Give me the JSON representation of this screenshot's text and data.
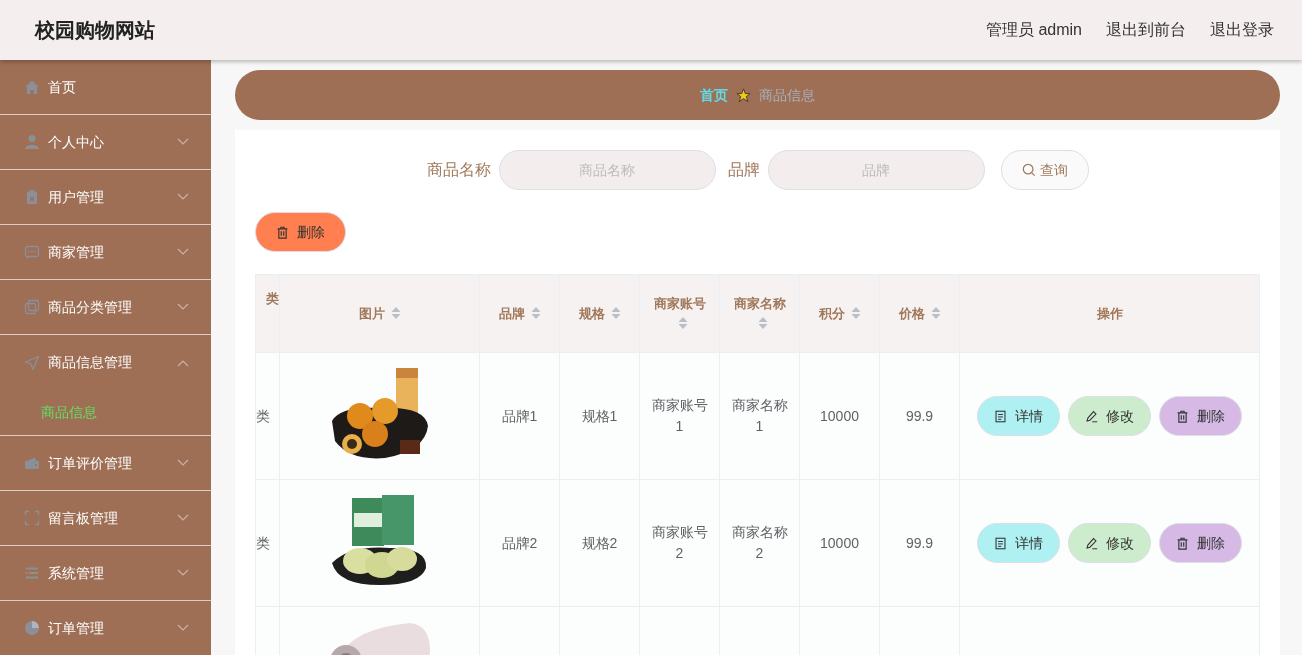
{
  "header": {
    "title": "校园购物网站",
    "links": [
      {
        "label": "管理员 admin"
      },
      {
        "label": "退出到前台"
      },
      {
        "label": "退出登录"
      }
    ]
  },
  "sidebar": {
    "items": [
      {
        "label": "首页"
      },
      {
        "label": "个人中心",
        "expanded": false
      },
      {
        "label": "用户管理",
        "expanded": false
      },
      {
        "label": "商家管理",
        "expanded": false
      },
      {
        "label": "商品分类管理",
        "expanded": false
      },
      {
        "label": "商品信息管理",
        "expanded": true,
        "children": [
          {
            "label": "商品信息",
            "selected": true
          }
        ]
      },
      {
        "label": "订单评价管理",
        "expanded": false
      },
      {
        "label": "留言板管理",
        "expanded": false
      },
      {
        "label": "系统管理",
        "expanded": false
      },
      {
        "label": "订单管理",
        "expanded": false
      }
    ]
  },
  "breadcrumb": [
    {
      "label": "首页"
    },
    {
      "label": "商品信息"
    }
  ],
  "search": {
    "fields": [
      {
        "label": "商品名称",
        "placeholder": "商品名称"
      },
      {
        "label": "品牌",
        "placeholder": "品牌"
      }
    ],
    "button": "查询"
  },
  "toolbar": {
    "delete_button": "删除"
  },
  "table": {
    "columns": [
      {
        "label": "类",
        "sortable": false
      },
      {
        "label": "图片",
        "sortable": true
      },
      {
        "label": "品牌",
        "sortable": true
      },
      {
        "label": "规格",
        "sortable": true
      },
      {
        "label": "商家账号",
        "sortable": true
      },
      {
        "label": "商家名称",
        "sortable": true
      },
      {
        "label": "积分",
        "sortable": true
      },
      {
        "label": "价格",
        "sortable": true
      },
      {
        "label": "操作",
        "sortable": false
      }
    ],
    "rows": [
      {
        "cells": [
          "类",
          {
            "kind": "picture"
          },
          "品牌1",
          "规格1",
          "商家账号1",
          "商家名称1",
          "10000",
          "99.9"
        ],
        "actions": [
          {
            "label": "详情",
            "color": "#aff0f2"
          },
          {
            "label": "修改",
            "color": "#cdebcd"
          },
          {
            "label": "删除",
            "color": "#d7b9e6"
          }
        ]
      },
      {
        "cells": [
          "类",
          {
            "kind": "picture"
          },
          "品牌2",
          "规格2",
          "商家账号2",
          "商家名称2",
          "10000",
          "99.9"
        ],
        "actions": [
          {
            "label": "详情",
            "color": "#aff0f2"
          },
          {
            "label": "修改",
            "color": "#cdebcd"
          },
          {
            "label": "删除",
            "color": "#d7b9e6"
          }
        ]
      },
      {
        "cells": [
          "",
          {
            "kind": "picture"
          },
          "",
          "",
          "",
          "",
          "",
          ""
        ]
      }
    ]
  }
}
